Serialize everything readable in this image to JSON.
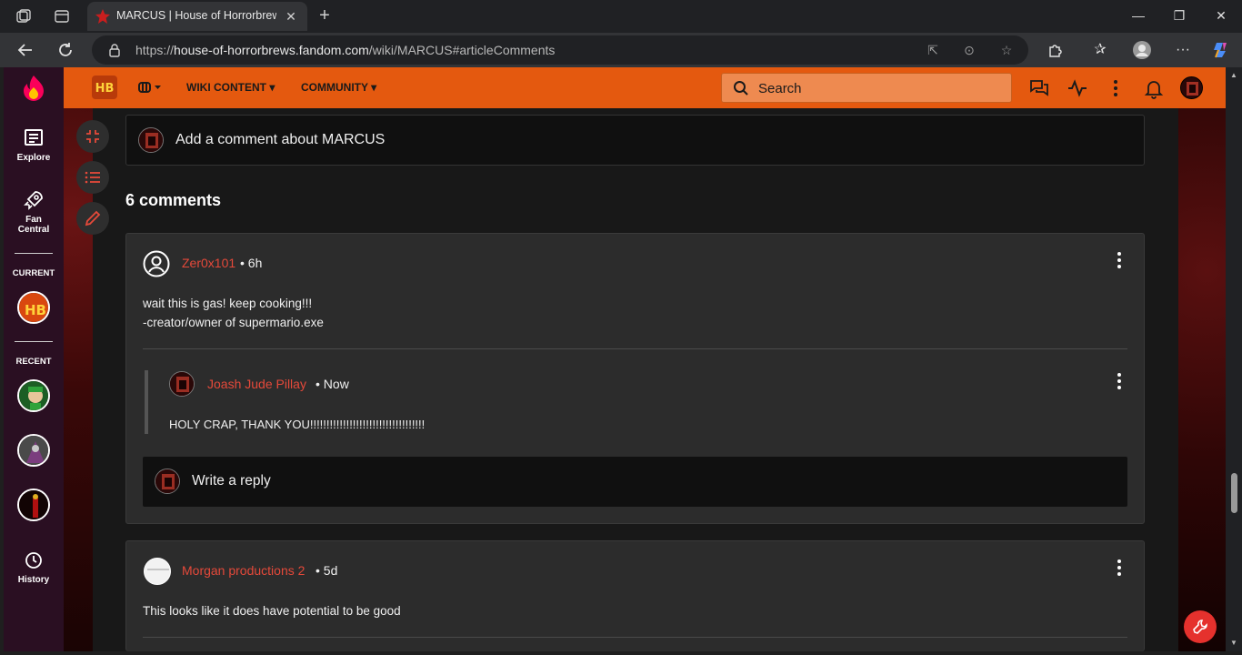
{
  "browser": {
    "tab_title": "MARCUS | House of Horrorbrews",
    "url_prefix": "https://",
    "url_domain": "house-of-horrorbrews.fandom.com",
    "url_path": "/wiki/MARCUS#articleComments"
  },
  "rail": {
    "explore": "Explore",
    "fan_central_line1": "Fan",
    "fan_central_line2": "Central",
    "current": "CURRENT",
    "recent": "RECENT",
    "history": "History"
  },
  "wiki_header": {
    "nav_wiki_content": "WIKI CONTENT",
    "nav_community": "COMMUNITY",
    "search_placeholder": "Search"
  },
  "comments": {
    "add_comment": "Add a comment about MARCUS",
    "count_label": "6 comments",
    "write_reply": "Write a reply",
    "threads": [
      {
        "author": "Zer0x101",
        "time": "6h",
        "lines": [
          "wait this is gas! keep cooking!!!",
          "-creator/owner of supermario.exe"
        ],
        "replies": [
          {
            "author": "Joash Jude Pillay",
            "time": "Now",
            "text": "HOLY CRAP, THANK YOU!!!!!!!!!!!!!!!!!!!!!!!!!!!!!!!!!!!"
          }
        ]
      },
      {
        "author": "Morgan productions 2",
        "time": "5d",
        "lines": [
          "This looks like it does have potential to be good"
        ]
      }
    ]
  },
  "colors": {
    "accent_orange": "#e4590f",
    "author_red": "#e5493a",
    "rail_bg": "#2a0f22"
  }
}
